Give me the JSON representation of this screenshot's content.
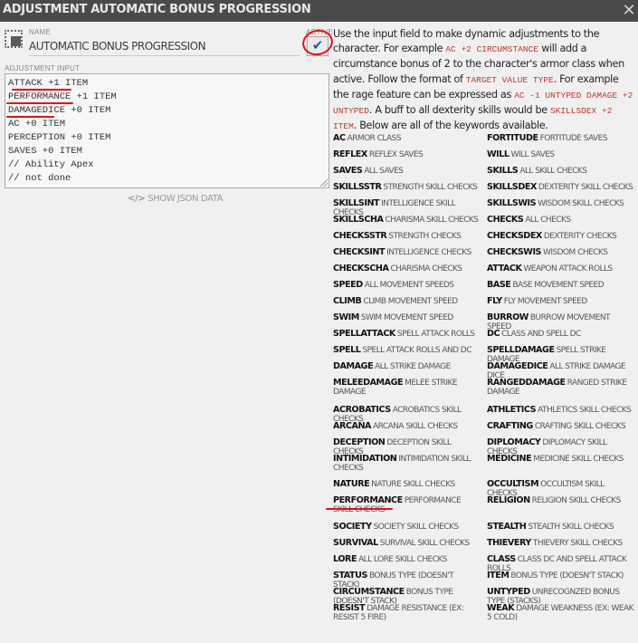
{
  "window": {
    "title": "ADJUSTMENT AUTOMATIC BONUS PROGRESSION",
    "close_glyph": "✕"
  },
  "name": {
    "label": "NAME",
    "value": "AUTOMATIC BONUS PROGRESSION"
  },
  "active": {
    "label": "ACTIVE",
    "checked": true,
    "glyph": "✔"
  },
  "adjustment_input": {
    "label": "ADJUSTMENT INPUT",
    "lines": [
      "ATTACK +1 ITEM",
      "PERFORMANCE +1 ITEM",
      "DAMAGEDICE +0 ITEM",
      "AC +0 ITEM",
      "PERCEPTION +0 ITEM",
      "SAVES +0 ITEM",
      "// Ability Apex",
      "// not done"
    ]
  },
  "show_json": {
    "icon": "</>",
    "label": "SHOW JSON DATA"
  },
  "help": {
    "p1": "Use the input field to make dynamic adjustments to the character. For example ",
    "ex1": "AC +2 CIRCUMSTANCE",
    "p2": " will add a circumstance bonus of 2 to the character's armor class when active. Follow the format of ",
    "ex2": "TARGET VALUE TYPE",
    "p3": ". For example the rage feature can be expressed as ",
    "ex3": "AC -1 UNTYPED DAMAGE +2 UNTYPED",
    "p4": ". A buff to all dexterity skills would be ",
    "ex4": "SKILLSDEX +2 ITEM",
    "p5": ". Below are all of the keywords available."
  },
  "keywords": [
    {
      "kw": "AC",
      "desc": "ARMOR CLASS"
    },
    {
      "kw": "FORTITUDE",
      "desc": "FORTITUDE SAVES"
    },
    {
      "kw": "REFLEX",
      "desc": "REFLEX SAVES"
    },
    {
      "kw": "WILL",
      "desc": "WILL SAVES"
    },
    {
      "kw": "SAVES",
      "desc": "ALL SAVES"
    },
    {
      "kw": "SKILLS",
      "desc": "ALL SKILL CHECKS"
    },
    {
      "kw": "SKILLSSTR",
      "desc": "STRENGTH SKILL CHECKS"
    },
    {
      "kw": "SKILLSDEX",
      "desc": "DEXTERITY SKILL CHECKS"
    },
    {
      "kw": "SKILLSINT",
      "desc": "INTELLIGENCE SKILL CHECKS"
    },
    {
      "kw": "SKILLSWIS",
      "desc": "WISDOM SKILL CHECKS"
    },
    {
      "kw": "SKILLSCHA",
      "desc": "CHARISMA SKILL CHECKS"
    },
    {
      "kw": "CHECKS",
      "desc": "ALL CHECKS"
    },
    {
      "kw": "CHECKSSTR",
      "desc": "STRENGTH CHECKS"
    },
    {
      "kw": "CHECKSDEX",
      "desc": "DEXTERITY CHECKS"
    },
    {
      "kw": "CHECKSINT",
      "desc": "INTELLIGENCE CHECKS"
    },
    {
      "kw": "CHECKSWIS",
      "desc": "WISDOM CHECKS"
    },
    {
      "kw": "CHECKSCHA",
      "desc": "CHARISMA CHECKS"
    },
    {
      "kw": "ATTACK",
      "desc": "WEAPON ATTACK ROLLS"
    },
    {
      "kw": "SPEED",
      "desc": "ALL MOVEMENT SPEEDS"
    },
    {
      "kw": "BASE",
      "desc": "BASE MOVEMENT SPEED"
    },
    {
      "kw": "CLIMB",
      "desc": "CLIMB MOVEMENT SPEED"
    },
    {
      "kw": "FLY",
      "desc": "FLY MOVEMENT SPEED"
    },
    {
      "kw": "SWIM",
      "desc": "SWIM MOVEMENT SPEED"
    },
    {
      "kw": "BURROW",
      "desc": "BURROW MOVEMENT SPEED"
    },
    {
      "kw": "SPELLATTACK",
      "desc": "SPELL ATTACK ROLLS"
    },
    {
      "kw": "DC",
      "desc": "CLASS AND SPELL DC"
    },
    {
      "kw": "SPELL",
      "desc": "SPELL ATTACK ROLLS AND DC"
    },
    {
      "kw": "SPELLDAMAGE",
      "desc": "SPELL STRIKE DAMAGE"
    },
    {
      "kw": "DAMAGE",
      "desc": "ALL STRIKE DAMAGE"
    },
    {
      "kw": "DAMAGEDICE",
      "desc": "ALL STRIKE DAMAGE DICE"
    },
    {
      "kw": "MELEEDAMAGE",
      "desc": "MELEE STRIKE DAMAGE"
    },
    {
      "kw": "RANGEDDAMAGE",
      "desc": "RANGED STRIKE DAMAGE"
    },
    {
      "kw": "ACROBATICS",
      "desc": "ACROBATICS SKILL CHECKS"
    },
    {
      "kw": "ATHLETICS",
      "desc": "ATHLETICS SKILL CHECKS"
    },
    {
      "kw": "ARCANA",
      "desc": "ARCANA SKILL CHECKS"
    },
    {
      "kw": "CRAFTING",
      "desc": "CRAFTING SKILL CHECKS"
    },
    {
      "kw": "DECEPTION",
      "desc": "DECEPTION SKILL CHECKS"
    },
    {
      "kw": "DIPLOMACY",
      "desc": "DIPLOMACY SKILL CHECKS"
    },
    {
      "kw": "INTIMIDATION",
      "desc": "INTIMIDATION SKILL CHECKS"
    },
    {
      "kw": "MEDICINE",
      "desc": "MEDICINE SKILL CHECKS"
    },
    {
      "kw": "NATURE",
      "desc": "NATURE SKILL CHECKS"
    },
    {
      "kw": "OCCULTISM",
      "desc": "OCCULTISM SKILL CHECKS"
    },
    {
      "kw": "PERFORMANCE",
      "desc": "PERFORMANCE SKILL CHECKS"
    },
    {
      "kw": "RELIGION",
      "desc": "RELIGION SKILL CHECKS"
    },
    {
      "kw": "SOCIETY",
      "desc": "SOCIETY SKILL CHECKS"
    },
    {
      "kw": "STEALTH",
      "desc": "STEALTH SKILL CHECKS"
    },
    {
      "kw": "SURVIVAL",
      "desc": "SURVIVAL SKILL CHECKS"
    },
    {
      "kw": "THIEVERY",
      "desc": "THIEVERY SKILL CHECKS"
    },
    {
      "kw": "LORE",
      "desc": "ALL LORE SKILL CHECKS"
    },
    {
      "kw": "CLASS",
      "desc": "CLASS DC AND SPELL ATTACK ROLLS"
    },
    {
      "kw": "STATUS",
      "desc": "BONUS TYPE (DOESN'T STACK)"
    },
    {
      "kw": "ITEM",
      "desc": "BONUS TYPE (DOESN'T STACK)"
    },
    {
      "kw": "CIRCUMSTANCE",
      "desc": "BONUS TYPE (DOESN'T STACK)"
    },
    {
      "kw": "UNTYPED",
      "desc": "UNRECOGNZED BONUS TYPE (STACKS)"
    },
    {
      "kw": "RESIST",
      "desc": "DAMAGE RESISTANCE (EX: RESIST 5 FIRE)"
    },
    {
      "kw": "WEAK",
      "desc": "DAMAGE WEAKNESS (EX: WEAK 5 COLD)"
    }
  ],
  "colors": {
    "titlebar": "#4a4a4a",
    "background": "#f0f0f0",
    "annotation": "#e0131a",
    "example_text": "#c0392b"
  }
}
